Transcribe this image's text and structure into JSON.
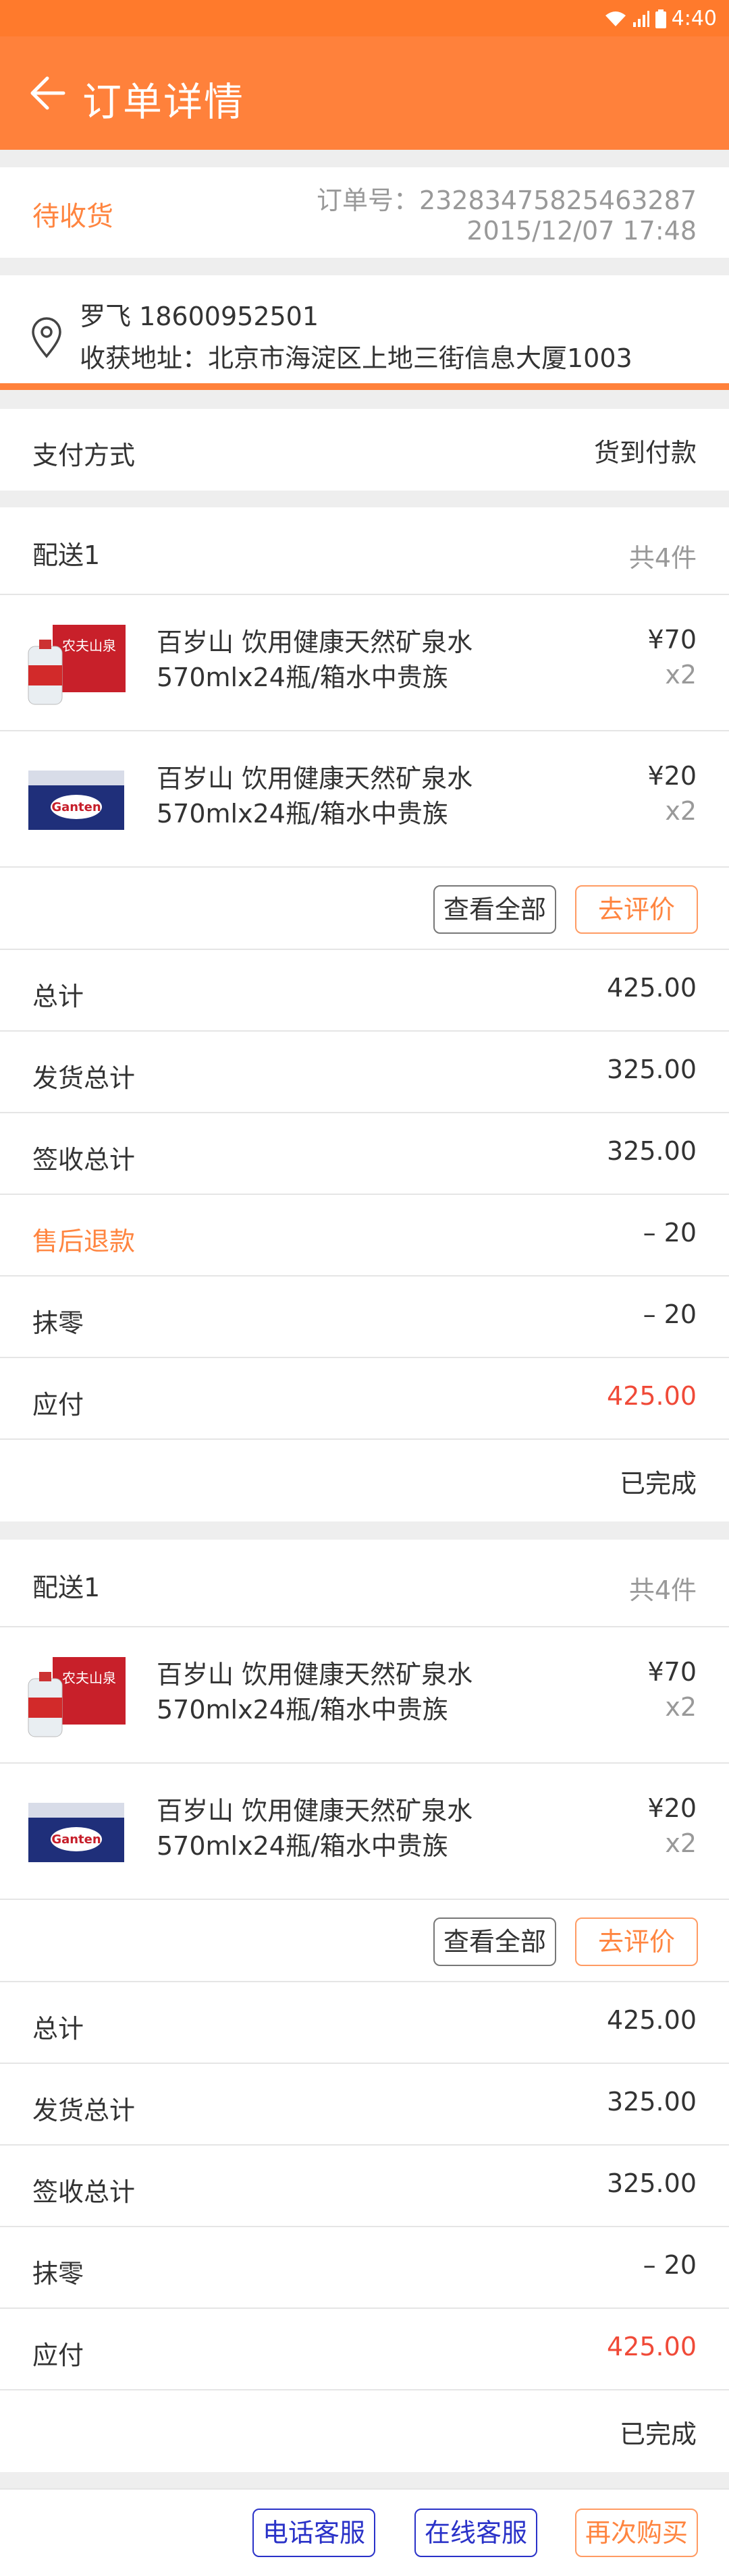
{
  "status": {
    "time": "4:40"
  },
  "header": {
    "title": "订单详情"
  },
  "order": {
    "status": "待收货",
    "number": "订单号：23283475825463287",
    "datetime": "2015/12/07  17:48"
  },
  "address": {
    "receiver": "罗飞    18600952501",
    "label_address": "收获地址：北京市海淀区上地三街信息大厦1003"
  },
  "payment": {
    "label": "支付方式",
    "value": "货到付款"
  },
  "deliveries": [
    {
      "title": "配送1",
      "count": "共4件",
      "items": [
        {
          "name": "百岁山  饮用健康天然矿泉水 570mlx24瓶/箱水中贵族",
          "price": "¥70",
          "qty": "x2",
          "img_text": "农夫山泉"
        },
        {
          "name": "百岁山  饮用健康天然矿泉水 570mlx24瓶/箱水中贵族",
          "price": "¥20",
          "qty": "x2",
          "img_text": "Ganten"
        }
      ],
      "view_all": "查看全部",
      "review": "去评价",
      "rows": [
        {
          "label": "总计",
          "value": "425.00"
        },
        {
          "label": "发货总计",
          "value": "325.00"
        },
        {
          "label": "签收总计",
          "value": "325.00"
        },
        {
          "label": "售后退款",
          "value": "– 20"
        },
        {
          "label": "抹零",
          "value": "– 20"
        },
        {
          "label": "应付",
          "value": "425.00"
        }
      ],
      "state": "已完成"
    },
    {
      "title": "配送1",
      "count": "共4件",
      "items": [
        {
          "name": "百岁山  饮用健康天然矿泉水 570mlx24瓶/箱水中贵族",
          "price": "¥70",
          "qty": "x2",
          "img_text": "农夫山泉"
        },
        {
          "name": "百岁山  饮用健康天然矿泉水 570mlx24瓶/箱水中贵族",
          "price": "¥20",
          "qty": "x2",
          "img_text": "Ganten"
        }
      ],
      "view_all": "查看全部",
      "review": "去评价",
      "rows": [
        {
          "label": "总计",
          "value": "425.00"
        },
        {
          "label": "发货总计",
          "value": "325.00"
        },
        {
          "label": "签收总计",
          "value": "325.00"
        },
        {
          "label": "抹零",
          "value": "– 20"
        },
        {
          "label": "应付",
          "value": "425.00"
        }
      ],
      "state": "已完成"
    }
  ],
  "footer": {
    "phone_service": "电话客服",
    "online_service": "在线客服",
    "rebuy": "再次购买"
  },
  "colors": {
    "accent": "#ff813b",
    "payable": "#f04a38",
    "service_blue": "#2a32c8"
  }
}
